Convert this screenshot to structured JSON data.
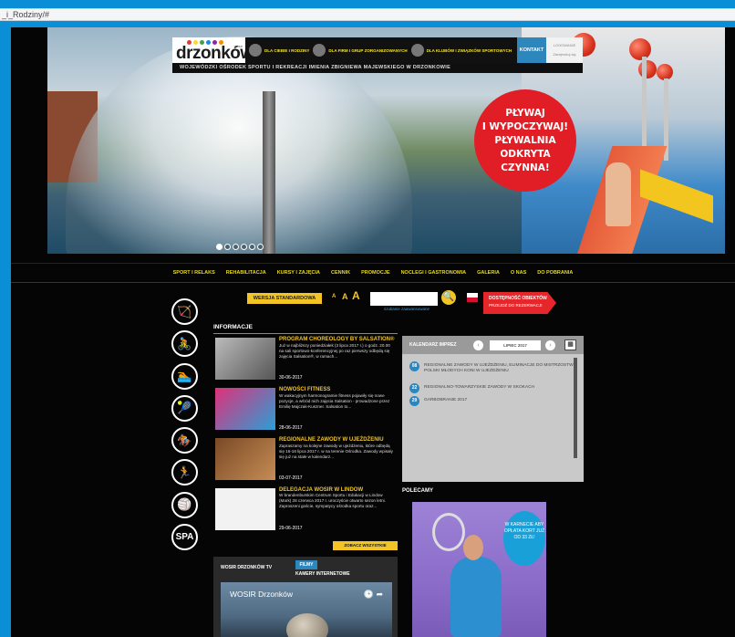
{
  "browser": {
    "url": "_i_Rodziny/#"
  },
  "header": {
    "logo_text": "drzonków",
    "logo_sub": "wosir",
    "nav": [
      "DLA CIEBIE I RODZINY",
      "DLA FIRM I GRUP ZORGANIZOWANYCH",
      "DLA KLUBÓW I ZWIĄZKÓW SPORTOWYCH"
    ],
    "kontakt": "KONTAKT",
    "login_lines": [
      "LOGOWANIE",
      "Zarejestruj się"
    ],
    "subtitle": "WOJEWÓDZKI OŚRODEK SPORTU I REKREACJI IMIENIA ZBIGNIEWA MAJEWSKIEGO W DRZONKOWIE"
  },
  "hero": {
    "promo": "PŁYWAJ\nI WYPOCZYWAJ!\nPŁYWALNIA ODKRYTA\nCZYNNA!",
    "slides_count": 6,
    "active_slide": 1
  },
  "menu": [
    "SPORT I RELAKS",
    "REHABILITACJA",
    "KURSY I ZAJĘCIA",
    "CENNIK",
    "PROMOCJE",
    "NOCLEGI I GASTRONOMIA",
    "GALERIA",
    "O NAS",
    "DO POBRANIA"
  ],
  "toolbar": {
    "version_label": "WERSJA STANDARDOWA",
    "font_small": "A",
    "font_medium": "A",
    "font_large": "A",
    "search_placeholder": "",
    "advanced_search": "szukanie zaawansowane",
    "search_icon": "🔍",
    "access_title": "DOSTĘPNOŚĆ OBIEKTÓW",
    "access_sub": "PRZEJDŹ DO REZERWACJI"
  },
  "side_icons": [
    "archery-icon",
    "cycling-icon",
    "swimming-icon",
    "tennis-icon",
    "horse-riding-icon",
    "fitness-icon",
    "volleyball-icon",
    "spa-icon"
  ],
  "spa_label": "SPA",
  "news": {
    "section_title": "INFORMACJE",
    "items": [
      {
        "title": "PROGRAM CHOREOLOGY BY SALSATION®",
        "body": "Już w najbliższy poniedziałek (3 lipca 2017 r.) o godz. 20.00 na sali sportowo-konferencyjnej po raz pierwszy odbędą się zajęcia Salsation®, w ramach...",
        "date": "30-06-2017"
      },
      {
        "title": "NOWOŚCI FITNESS",
        "body": "W wakacyjnym harmonogramie fitness pojawiły się nowe pozycje, a wśród nich zajęcia Salsation - prowadzone przez Emilię Majczak-Kuszner. Salsation to...",
        "date": "28-06-2017"
      },
      {
        "title": "REGIONALNE ZAWODY W UJEŻDŻENIU",
        "body": "Zapraszamy na kolejne zawody w ujeżdżeniu, które odbędą się 15-16 lipca 2017 r. w na terenie Ośrodka. Zawody wpisały się już na stałe w kalendarz...",
        "date": "03-07-2017"
      },
      {
        "title": "DELEGACJA WOSIR W LINDOW",
        "body": "W brandenburskim Centrum Sportu i Edukacji w Lindow (Mark) 28 czerwca 2017 r. uroczyście otwarto sezon letni. Zaproszeni goście, sympatycy ośrodka sportu oraz...",
        "date": "29-06-2017"
      }
    ],
    "see_all": "ZOBACZ WSZYSTKIE"
  },
  "tv": {
    "title": "WOSIR DRZONKÓW TV",
    "tab_films": "FILMY",
    "tab_cameras": "KAMERY INTERNETOWE",
    "video_title": "WOSIR Drzonków"
  },
  "calendar": {
    "title": "KALENDARZ IMPREZ",
    "month": "LIPIEC 2017",
    "events": [
      {
        "day": "08",
        "text": "REGIONALNE ZAWODY W UJEŻDŻENIU, ELIMINACJE DO MISTRZOSTW POLSKI MŁODYCH KONI W UJEŻDŻENIU"
      },
      {
        "day": "22",
        "text": "REGIONALNO-TOWARZYSKIE ZAWODY W SKOKACH"
      },
      {
        "day": "29",
        "text": "GARBOBRANIE 2017"
      }
    ]
  },
  "polecamy": {
    "title": "POLECAMY",
    "ad_text": "W KARNECIE ABY OPŁATA KORT JUŻ OD 33 ZŁ!"
  },
  "colors": {
    "accent_yellow": "#f3c524",
    "accent_blue": "#2d87bd",
    "accent_red": "#e11d26",
    "page_bg": "#050505"
  }
}
